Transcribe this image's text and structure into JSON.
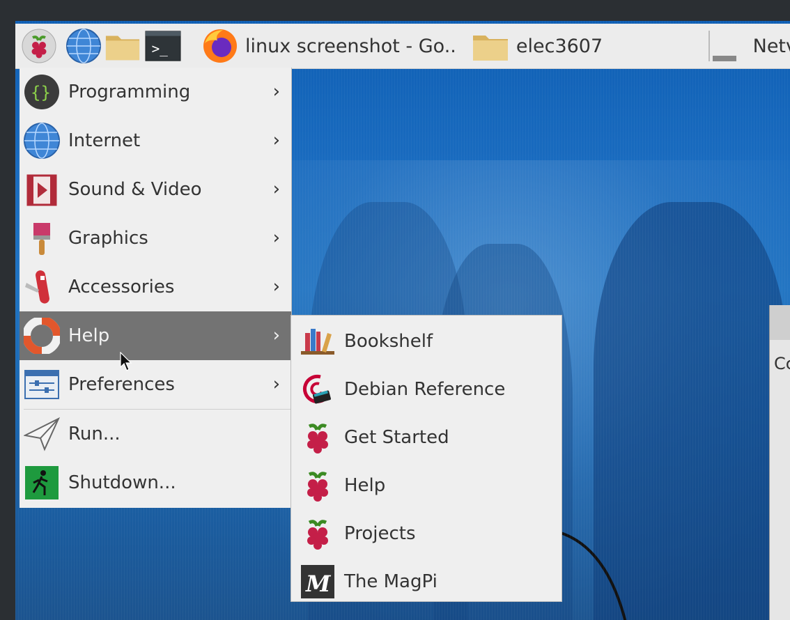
{
  "taskbar": {
    "items": [
      {
        "label": "linux screenshot - Go..",
        "icon": "firefox-icon"
      },
      {
        "label": "elec3607",
        "icon": "folder-icon"
      }
    ],
    "network_label": "Netv"
  },
  "menu": {
    "items": [
      {
        "label": "Programming",
        "arrow": "›",
        "icon": "programming-icon"
      },
      {
        "label": "Internet",
        "arrow": "›",
        "icon": "globe-icon"
      },
      {
        "label": "Sound & Video",
        "arrow": "›",
        "icon": "sound-video-icon"
      },
      {
        "label": "Graphics",
        "arrow": "›",
        "icon": "paintbrush-icon"
      },
      {
        "label": "Accessories",
        "arrow": "›",
        "icon": "swiss-knife-icon"
      },
      {
        "label": "Help",
        "arrow": "›",
        "icon": "lifebuoy-icon",
        "active": true
      },
      {
        "label": "Preferences",
        "arrow": "›",
        "icon": "preferences-icon"
      },
      {
        "label": "Run...",
        "icon": "paper-plane-icon"
      },
      {
        "label": "Shutdown...",
        "icon": "exit-runner-icon"
      }
    ]
  },
  "submenu": {
    "items": [
      {
        "label": "Bookshelf",
        "icon": "bookshelf-icon"
      },
      {
        "label": "Debian Reference",
        "icon": "debian-icon"
      },
      {
        "label": "Get Started",
        "icon": "raspberry-icon"
      },
      {
        "label": "Help",
        "icon": "raspberry-icon"
      },
      {
        "label": "Projects",
        "icon": "raspberry-icon"
      },
      {
        "label": "The MagPi",
        "icon": "magpi-icon"
      }
    ]
  },
  "right_window": {
    "partial_text": "Cc"
  },
  "colors": {
    "panel_bg": "#ececec",
    "menu_bg": "#efefef",
    "highlight": "#737373",
    "desktop_blue": "#1a6cc0"
  }
}
